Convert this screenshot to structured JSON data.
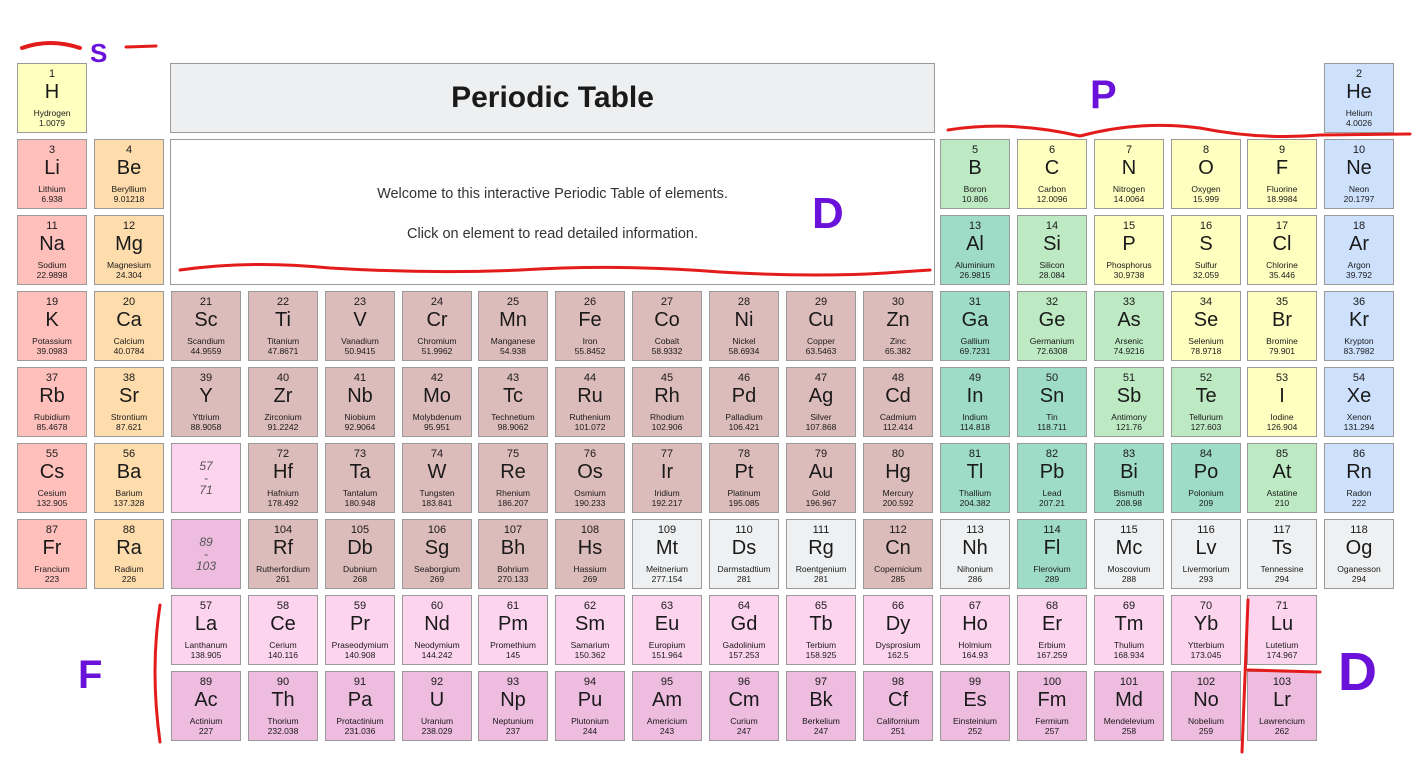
{
  "title": "Periodic Table",
  "welcome": {
    "line1": "Welcome to this interactive Periodic Table of elements.",
    "line2": "Click on element to read detailed information."
  },
  "categories": {
    "alkali": "#ffc0bc",
    "alkaline_earth": "#fedcac",
    "transition": "#dcbcba",
    "post_transition": "#9fdcc8",
    "metalloid": "#bde9c3",
    "nonmetal": "#ffffc0",
    "noble_gas": "#cde1fd",
    "lanthanide": "#fcd4ee",
    "actinide": "#edbcdf",
    "unknown": "#eff0f1"
  },
  "annotation_labels": [
    "S",
    "P",
    "D",
    "F",
    "D"
  ],
  "annotation_colors": {
    "ink_red": "#e31b1b",
    "ink_purple": "#6a12d9"
  },
  "placeholders": [
    {
      "range": "57\n-\n71",
      "row": 6,
      "col": 3,
      "cat": "lanthanide"
    },
    {
      "range": "89\n-\n103",
      "row": 7,
      "col": 3,
      "cat": "actinide"
    }
  ],
  "elements": [
    {
      "n": "1",
      "s": "H",
      "name": "Hydrogen",
      "m": "1.0079",
      "row": 1,
      "col": 1,
      "cat": "nonmetal"
    },
    {
      "n": "2",
      "s": "He",
      "name": "Helium",
      "m": "4.0026",
      "row": 1,
      "col": 18,
      "cat": "noble_gas"
    },
    {
      "n": "3",
      "s": "Li",
      "name": "Lithium",
      "m": "6.938",
      "row": 2,
      "col": 1,
      "cat": "alkali"
    },
    {
      "n": "4",
      "s": "Be",
      "name": "Beryllium",
      "m": "9.01218",
      "row": 2,
      "col": 2,
      "cat": "alkaline_earth"
    },
    {
      "n": "5",
      "s": "B",
      "name": "Boron",
      "m": "10.806",
      "row": 2,
      "col": 13,
      "cat": "metalloid"
    },
    {
      "n": "6",
      "s": "C",
      "name": "Carbon",
      "m": "12.0096",
      "row": 2,
      "col": 14,
      "cat": "nonmetal"
    },
    {
      "n": "7",
      "s": "N",
      "name": "Nitrogen",
      "m": "14.0064",
      "row": 2,
      "col": 15,
      "cat": "nonmetal"
    },
    {
      "n": "8",
      "s": "O",
      "name": "Oxygen",
      "m": "15.999",
      "row": 2,
      "col": 16,
      "cat": "nonmetal"
    },
    {
      "n": "9",
      "s": "F",
      "name": "Fluorine",
      "m": "18.9984",
      "row": 2,
      "col": 17,
      "cat": "nonmetal"
    },
    {
      "n": "10",
      "s": "Ne",
      "name": "Neon",
      "m": "20.1797",
      "row": 2,
      "col": 18,
      "cat": "noble_gas"
    },
    {
      "n": "11",
      "s": "Na",
      "name": "Sodium",
      "m": "22.9898",
      "row": 3,
      "col": 1,
      "cat": "alkali"
    },
    {
      "n": "12",
      "s": "Mg",
      "name": "Magnesium",
      "m": "24.304",
      "row": 3,
      "col": 2,
      "cat": "alkaline_earth"
    },
    {
      "n": "13",
      "s": "Al",
      "name": "Aluminium",
      "m": "26.9815",
      "row": 3,
      "col": 13,
      "cat": "post_transition"
    },
    {
      "n": "14",
      "s": "Si",
      "name": "Silicon",
      "m": "28.084",
      "row": 3,
      "col": 14,
      "cat": "metalloid"
    },
    {
      "n": "15",
      "s": "P",
      "name": "Phosphorus",
      "m": "30.9738",
      "row": 3,
      "col": 15,
      "cat": "nonmetal"
    },
    {
      "n": "16",
      "s": "S",
      "name": "Sulfur",
      "m": "32.059",
      "row": 3,
      "col": 16,
      "cat": "nonmetal"
    },
    {
      "n": "17",
      "s": "Cl",
      "name": "Chlorine",
      "m": "35.446",
      "row": 3,
      "col": 17,
      "cat": "nonmetal"
    },
    {
      "n": "18",
      "s": "Ar",
      "name": "Argon",
      "m": "39.792",
      "row": 3,
      "col": 18,
      "cat": "noble_gas"
    },
    {
      "n": "19",
      "s": "K",
      "name": "Potassium",
      "m": "39.0983",
      "row": 4,
      "col": 1,
      "cat": "alkali"
    },
    {
      "n": "20",
      "s": "Ca",
      "name": "Calcium",
      "m": "40.0784",
      "row": 4,
      "col": 2,
      "cat": "alkaline_earth"
    },
    {
      "n": "21",
      "s": "Sc",
      "name": "Scandium",
      "m": "44.9559",
      "row": 4,
      "col": 3,
      "cat": "transition"
    },
    {
      "n": "22",
      "s": "Ti",
      "name": "Titanium",
      "m": "47.8671",
      "row": 4,
      "col": 4,
      "cat": "transition"
    },
    {
      "n": "23",
      "s": "V",
      "name": "Vanadium",
      "m": "50.9415",
      "row": 4,
      "col": 5,
      "cat": "transition"
    },
    {
      "n": "24",
      "s": "Cr",
      "name": "Chromium",
      "m": "51.9962",
      "row": 4,
      "col": 6,
      "cat": "transition"
    },
    {
      "n": "25",
      "s": "Mn",
      "name": "Manganese",
      "m": "54.938",
      "row": 4,
      "col": 7,
      "cat": "transition"
    },
    {
      "n": "26",
      "s": "Fe",
      "name": "Iron",
      "m": "55.8452",
      "row": 4,
      "col": 8,
      "cat": "transition"
    },
    {
      "n": "27",
      "s": "Co",
      "name": "Cobalt",
      "m": "58.9332",
      "row": 4,
      "col": 9,
      "cat": "transition"
    },
    {
      "n": "28",
      "s": "Ni",
      "name": "Nickel",
      "m": "58.6934",
      "row": 4,
      "col": 10,
      "cat": "transition"
    },
    {
      "n": "29",
      "s": "Cu",
      "name": "Copper",
      "m": "63.5463",
      "row": 4,
      "col": 11,
      "cat": "transition"
    },
    {
      "n": "30",
      "s": "Zn",
      "name": "Zinc",
      "m": "65.382",
      "row": 4,
      "col": 12,
      "cat": "transition"
    },
    {
      "n": "31",
      "s": "Ga",
      "name": "Gallium",
      "m": "69.7231",
      "row": 4,
      "col": 13,
      "cat": "post_transition"
    },
    {
      "n": "32",
      "s": "Ge",
      "name": "Germanium",
      "m": "72.6308",
      "row": 4,
      "col": 14,
      "cat": "metalloid"
    },
    {
      "n": "33",
      "s": "As",
      "name": "Arsenic",
      "m": "74.9216",
      "row": 4,
      "col": 15,
      "cat": "metalloid"
    },
    {
      "n": "34",
      "s": "Se",
      "name": "Selenium",
      "m": "78.9718",
      "row": 4,
      "col": 16,
      "cat": "nonmetal"
    },
    {
      "n": "35",
      "s": "Br",
      "name": "Bromine",
      "m": "79.901",
      "row": 4,
      "col": 17,
      "cat": "nonmetal"
    },
    {
      "n": "36",
      "s": "Kr",
      "name": "Krypton",
      "m": "83.7982",
      "row": 4,
      "col": 18,
      "cat": "noble_gas"
    },
    {
      "n": "37",
      "s": "Rb",
      "name": "Rubidium",
      "m": "85.4678",
      "row": 5,
      "col": 1,
      "cat": "alkali"
    },
    {
      "n": "38",
      "s": "Sr",
      "name": "Strontium",
      "m": "87.621",
      "row": 5,
      "col": 2,
      "cat": "alkaline_earth"
    },
    {
      "n": "39",
      "s": "Y",
      "name": "Yttrium",
      "m": "88.9058",
      "row": 5,
      "col": 3,
      "cat": "transition"
    },
    {
      "n": "40",
      "s": "Zr",
      "name": "Zirconium",
      "m": "91.2242",
      "row": 5,
      "col": 4,
      "cat": "transition"
    },
    {
      "n": "41",
      "s": "Nb",
      "name": "Niobium",
      "m": "92.9064",
      "row": 5,
      "col": 5,
      "cat": "transition"
    },
    {
      "n": "42",
      "s": "Mo",
      "name": "Molybdenum",
      "m": "95.951",
      "row": 5,
      "col": 6,
      "cat": "transition"
    },
    {
      "n": "43",
      "s": "Tc",
      "name": "Technetium",
      "m": "98.9062",
      "row": 5,
      "col": 7,
      "cat": "transition"
    },
    {
      "n": "44",
      "s": "Ru",
      "name": "Ruthenium",
      "m": "101.072",
      "row": 5,
      "col": 8,
      "cat": "transition"
    },
    {
      "n": "45",
      "s": "Rh",
      "name": "Rhodium",
      "m": "102.906",
      "row": 5,
      "col": 9,
      "cat": "transition"
    },
    {
      "n": "46",
      "s": "Pd",
      "name": "Palladium",
      "m": "106.421",
      "row": 5,
      "col": 10,
      "cat": "transition"
    },
    {
      "n": "47",
      "s": "Ag",
      "name": "Silver",
      "m": "107.868",
      "row": 5,
      "col": 11,
      "cat": "transition"
    },
    {
      "n": "48",
      "s": "Cd",
      "name": "Cadmium",
      "m": "112.414",
      "row": 5,
      "col": 12,
      "cat": "transition"
    },
    {
      "n": "49",
      "s": "In",
      "name": "Indium",
      "m": "114.818",
      "row": 5,
      "col": 13,
      "cat": "post_transition"
    },
    {
      "n": "50",
      "s": "Sn",
      "name": "Tin",
      "m": "118.711",
      "row": 5,
      "col": 14,
      "cat": "post_transition"
    },
    {
      "n": "51",
      "s": "Sb",
      "name": "Antimony",
      "m": "121.76",
      "row": 5,
      "col": 15,
      "cat": "metalloid"
    },
    {
      "n": "52",
      "s": "Te",
      "name": "Tellurium",
      "m": "127.603",
      "row": 5,
      "col": 16,
      "cat": "metalloid"
    },
    {
      "n": "53",
      "s": "I",
      "name": "Iodine",
      "m": "126.904",
      "row": 5,
      "col": 17,
      "cat": "nonmetal"
    },
    {
      "n": "54",
      "s": "Xe",
      "name": "Xenon",
      "m": "131.294",
      "row": 5,
      "col": 18,
      "cat": "noble_gas"
    },
    {
      "n": "55",
      "s": "Cs",
      "name": "Cesium",
      "m": "132.905",
      "row": 6,
      "col": 1,
      "cat": "alkali"
    },
    {
      "n": "56",
      "s": "Ba",
      "name": "Barium",
      "m": "137.328",
      "row": 6,
      "col": 2,
      "cat": "alkaline_earth"
    },
    {
      "n": "72",
      "s": "Hf",
      "name": "Hafnium",
      "m": "178.492",
      "row": 6,
      "col": 4,
      "cat": "transition"
    },
    {
      "n": "73",
      "s": "Ta",
      "name": "Tantalum",
      "m": "180.948",
      "row": 6,
      "col": 5,
      "cat": "transition"
    },
    {
      "n": "74",
      "s": "W",
      "name": "Tungsten",
      "m": "183.841",
      "row": 6,
      "col": 6,
      "cat": "transition"
    },
    {
      "n": "75",
      "s": "Re",
      "name": "Rhenium",
      "m": "186.207",
      "row": 6,
      "col": 7,
      "cat": "transition"
    },
    {
      "n": "76",
      "s": "Os",
      "name": "Osmium",
      "m": "190.233",
      "row": 6,
      "col": 8,
      "cat": "transition"
    },
    {
      "n": "77",
      "s": "Ir",
      "name": "Iridium",
      "m": "192.217",
      "row": 6,
      "col": 9,
      "cat": "transition"
    },
    {
      "n": "78",
      "s": "Pt",
      "name": "Platinum",
      "m": "195.085",
      "row": 6,
      "col": 10,
      "cat": "transition"
    },
    {
      "n": "79",
      "s": "Au",
      "name": "Gold",
      "m": "196.967",
      "row": 6,
      "col": 11,
      "cat": "transition"
    },
    {
      "n": "80",
      "s": "Hg",
      "name": "Mercury",
      "m": "200.592",
      "row": 6,
      "col": 12,
      "cat": "transition"
    },
    {
      "n": "81",
      "s": "Tl",
      "name": "Thallium",
      "m": "204.382",
      "row": 6,
      "col": 13,
      "cat": "post_transition"
    },
    {
      "n": "82",
      "s": "Pb",
      "name": "Lead",
      "m": "207.21",
      "row": 6,
      "col": 14,
      "cat": "post_transition"
    },
    {
      "n": "83",
      "s": "Bi",
      "name": "Bismuth",
      "m": "208.98",
      "row": 6,
      "col": 15,
      "cat": "post_transition"
    },
    {
      "n": "84",
      "s": "Po",
      "name": "Polonium",
      "m": "209",
      "row": 6,
      "col": 16,
      "cat": "post_transition"
    },
    {
      "n": "85",
      "s": "At",
      "name": "Astatine",
      "m": "210",
      "row": 6,
      "col": 17,
      "cat": "metalloid"
    },
    {
      "n": "86",
      "s": "Rn",
      "name": "Radon",
      "m": "222",
      "row": 6,
      "col": 18,
      "cat": "noble_gas"
    },
    {
      "n": "87",
      "s": "Fr",
      "name": "Francium",
      "m": "223",
      "row": 7,
      "col": 1,
      "cat": "alkali"
    },
    {
      "n": "88",
      "s": "Ra",
      "name": "Radium",
      "m": "226",
      "row": 7,
      "col": 2,
      "cat": "alkaline_earth"
    },
    {
      "n": "104",
      "s": "Rf",
      "name": "Rutherfordium",
      "m": "261",
      "row": 7,
      "col": 4,
      "cat": "transition"
    },
    {
      "n": "105",
      "s": "Db",
      "name": "Dubnium",
      "m": "268",
      "row": 7,
      "col": 5,
      "cat": "transition"
    },
    {
      "n": "106",
      "s": "Sg",
      "name": "Seaborgium",
      "m": "269",
      "row": 7,
      "col": 6,
      "cat": "transition"
    },
    {
      "n": "107",
      "s": "Bh",
      "name": "Bohrium",
      "m": "270.133",
      "row": 7,
      "col": 7,
      "cat": "transition"
    },
    {
      "n": "108",
      "s": "Hs",
      "name": "Hassium",
      "m": "269",
      "row": 7,
      "col": 8,
      "cat": "transition"
    },
    {
      "n": "109",
      "s": "Mt",
      "name": "Meitnerium",
      "m": "277.154",
      "row": 7,
      "col": 9,
      "cat": "unknown"
    },
    {
      "n": "110",
      "s": "Ds",
      "name": "Darmstadtium",
      "m": "281",
      "row": 7,
      "col": 10,
      "cat": "unknown"
    },
    {
      "n": "111",
      "s": "Rg",
      "name": "Roentgenium",
      "m": "281",
      "row": 7,
      "col": 11,
      "cat": "unknown"
    },
    {
      "n": "112",
      "s": "Cn",
      "name": "Copernicium",
      "m": "285",
      "row": 7,
      "col": 12,
      "cat": "transition"
    },
    {
      "n": "113",
      "s": "Nh",
      "name": "Nihonium",
      "m": "286",
      "row": 7,
      "col": 13,
      "cat": "unknown"
    },
    {
      "n": "114",
      "s": "Fl",
      "name": "Flerovium",
      "m": "289",
      "row": 7,
      "col": 14,
      "cat": "post_transition"
    },
    {
      "n": "115",
      "s": "Mc",
      "name": "Moscovium",
      "m": "288",
      "row": 7,
      "col": 15,
      "cat": "unknown"
    },
    {
      "n": "116",
      "s": "Lv",
      "name": "Livermorium",
      "m": "293",
      "row": 7,
      "col": 16,
      "cat": "unknown"
    },
    {
      "n": "117",
      "s": "Ts",
      "name": "Tennessine",
      "m": "294",
      "row": 7,
      "col": 17,
      "cat": "unknown"
    },
    {
      "n": "118",
      "s": "Og",
      "name": "Oganesson",
      "m": "294",
      "row": 7,
      "col": 18,
      "cat": "unknown"
    },
    {
      "n": "57",
      "s": "La",
      "name": "Lanthanum",
      "m": "138.905",
      "row": 8,
      "col": 3,
      "cat": "lanthanide"
    },
    {
      "n": "58",
      "s": "Ce",
      "name": "Cerium",
      "m": "140.116",
      "row": 8,
      "col": 4,
      "cat": "lanthanide"
    },
    {
      "n": "59",
      "s": "Pr",
      "name": "Praseodymium",
      "m": "140.908",
      "row": 8,
      "col": 5,
      "cat": "lanthanide"
    },
    {
      "n": "60",
      "s": "Nd",
      "name": "Neodymium",
      "m": "144.242",
      "row": 8,
      "col": 6,
      "cat": "lanthanide"
    },
    {
      "n": "61",
      "s": "Pm",
      "name": "Promethium",
      "m": "145",
      "row": 8,
      "col": 7,
      "cat": "lanthanide"
    },
    {
      "n": "62",
      "s": "Sm",
      "name": "Samarium",
      "m": "150.362",
      "row": 8,
      "col": 8,
      "cat": "lanthanide"
    },
    {
      "n": "63",
      "s": "Eu",
      "name": "Europium",
      "m": "151.964",
      "row": 8,
      "col": 9,
      "cat": "lanthanide"
    },
    {
      "n": "64",
      "s": "Gd",
      "name": "Gadolinium",
      "m": "157.253",
      "row": 8,
      "col": 10,
      "cat": "lanthanide"
    },
    {
      "n": "65",
      "s": "Tb",
      "name": "Terbium",
      "m": "158.925",
      "row": 8,
      "col": 11,
      "cat": "lanthanide"
    },
    {
      "n": "66",
      "s": "Dy",
      "name": "Dysprosium",
      "m": "162.5",
      "row": 8,
      "col": 12,
      "cat": "lanthanide"
    },
    {
      "n": "67",
      "s": "Ho",
      "name": "Holmium",
      "m": "164.93",
      "row": 8,
      "col": 13,
      "cat": "lanthanide"
    },
    {
      "n": "68",
      "s": "Er",
      "name": "Erbium",
      "m": "167.259",
      "row": 8,
      "col": 14,
      "cat": "lanthanide"
    },
    {
      "n": "69",
      "s": "Tm",
      "name": "Thulium",
      "m": "168.934",
      "row": 8,
      "col": 15,
      "cat": "lanthanide"
    },
    {
      "n": "70",
      "s": "Yb",
      "name": "Ytterbium",
      "m": "173.045",
      "row": 8,
      "col": 16,
      "cat": "lanthanide"
    },
    {
      "n": "71",
      "s": "Lu",
      "name": "Lutetium",
      "m": "174.967",
      "row": 8,
      "col": 17,
      "cat": "lanthanide"
    },
    {
      "n": "89",
      "s": "Ac",
      "name": "Actinium",
      "m": "227",
      "row": 9,
      "col": 3,
      "cat": "actinide"
    },
    {
      "n": "90",
      "s": "Th",
      "name": "Thorium",
      "m": "232.038",
      "row": 9,
      "col": 4,
      "cat": "actinide"
    },
    {
      "n": "91",
      "s": "Pa",
      "name": "Protactinium",
      "m": "231.036",
      "row": 9,
      "col": 5,
      "cat": "actinide"
    },
    {
      "n": "92",
      "s": "U",
      "name": "Uranium",
      "m": "238.029",
      "row": 9,
      "col": 6,
      "cat": "actinide"
    },
    {
      "n": "93",
      "s": "Np",
      "name": "Neptunium",
      "m": "237",
      "row": 9,
      "col": 7,
      "cat": "actinide"
    },
    {
      "n": "94",
      "s": "Pu",
      "name": "Plutonium",
      "m": "244",
      "row": 9,
      "col": 8,
      "cat": "actinide"
    },
    {
      "n": "95",
      "s": "Am",
      "name": "Americium",
      "m": "243",
      "row": 9,
      "col": 9,
      "cat": "actinide"
    },
    {
      "n": "96",
      "s": "Cm",
      "name": "Curium",
      "m": "247",
      "row": 9,
      "col": 10,
      "cat": "actinide"
    },
    {
      "n": "97",
      "s": "Bk",
      "name": "Berkelium",
      "m": "247",
      "row": 9,
      "col": 11,
      "cat": "actinide"
    },
    {
      "n": "98",
      "s": "Cf",
      "name": "Californium",
      "m": "251",
      "row": 9,
      "col": 12,
      "cat": "actinide"
    },
    {
      "n": "99",
      "s": "Es",
      "name": "Einsteinium",
      "m": "252",
      "row": 9,
      "col": 13,
      "cat": "actinide"
    },
    {
      "n": "100",
      "s": "Fm",
      "name": "Fermium",
      "m": "257",
      "row": 9,
      "col": 14,
      "cat": "actinide"
    },
    {
      "n": "101",
      "s": "Md",
      "name": "Mendelevium",
      "m": "258",
      "row": 9,
      "col": 15,
      "cat": "actinide"
    },
    {
      "n": "102",
      "s": "No",
      "name": "Nobelium",
      "m": "259",
      "row": 9,
      "col": 16,
      "cat": "actinide"
    },
    {
      "n": "103",
      "s": "Lr",
      "name": "Lawrencium",
      "m": "262",
      "row": 9,
      "col": 17,
      "cat": "actinide"
    }
  ]
}
